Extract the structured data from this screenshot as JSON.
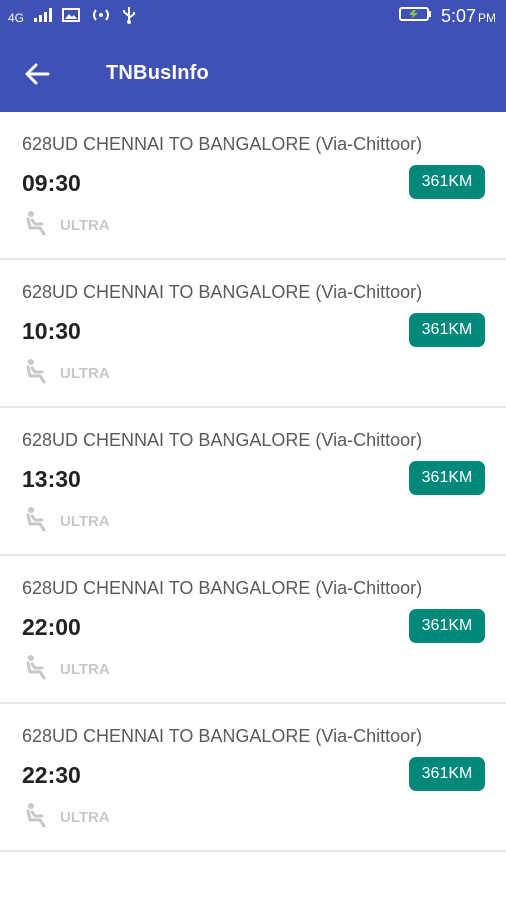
{
  "status_bar": {
    "network": "4G",
    "time": "5:07",
    "ampm": "PM"
  },
  "app_bar": {
    "title": "TNBusInfo",
    "back_icon": "arrow-back-icon"
  },
  "buses": [
    {
      "route": "628UD CHENNAI TO BANGALORE (Via-Chittoor)",
      "departure": "09:30",
      "distance": "361KM",
      "bus_type": "ULTRA"
    },
    {
      "route": "628UD CHENNAI TO BANGALORE (Via-Chittoor)",
      "departure": "10:30",
      "distance": "361KM",
      "bus_type": "ULTRA"
    },
    {
      "route": "628UD CHENNAI TO BANGALORE (Via-Chittoor)",
      "departure": "13:30",
      "distance": "361KM",
      "bus_type": "ULTRA"
    },
    {
      "route": "628UD CHENNAI TO BANGALORE (Via-Chittoor)",
      "departure": "22:00",
      "distance": "361KM",
      "bus_type": "ULTRA"
    },
    {
      "route": "628UD CHENNAI TO BANGALORE (Via-Chittoor)",
      "departure": "22:30",
      "distance": "361KM",
      "bus_type": "ULTRA"
    }
  ],
  "colors": {
    "primary": "#3f51b5",
    "accent": "#00897b"
  }
}
